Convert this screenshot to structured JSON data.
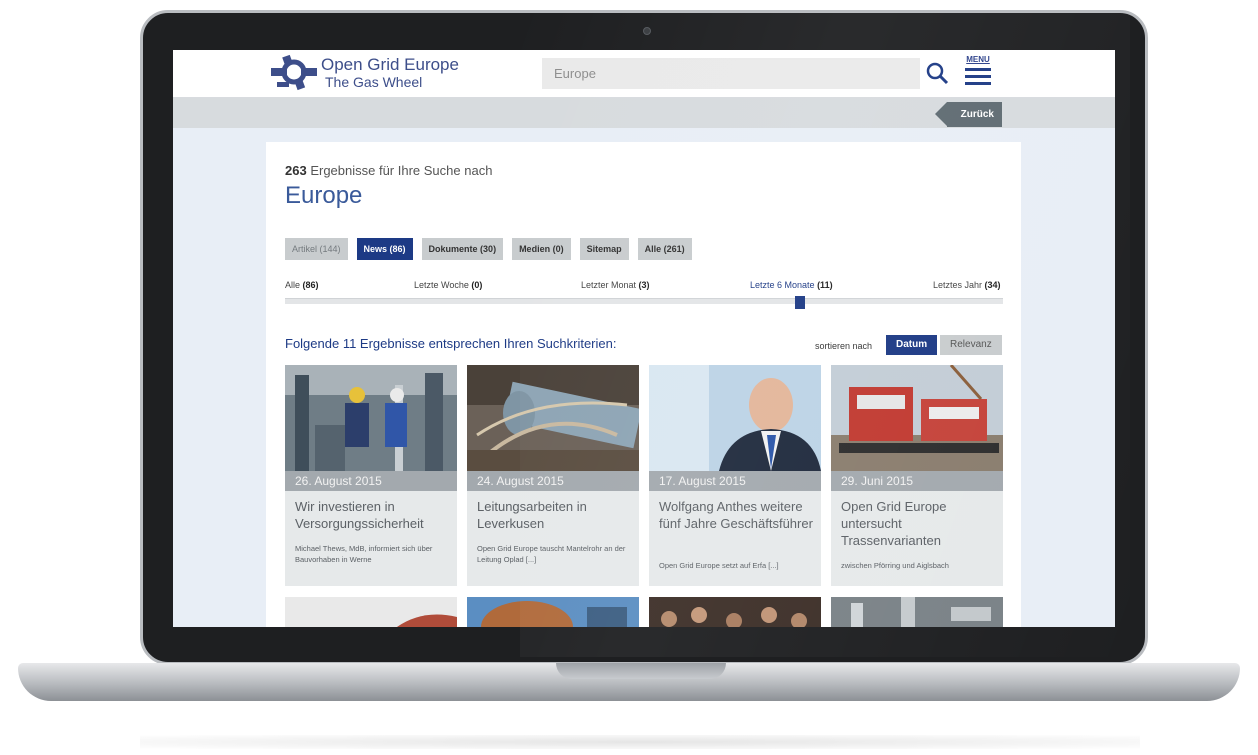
{
  "brand": {
    "name": "Open Grid Europe",
    "tagline": "The Gas Wheel"
  },
  "search": {
    "value": "Europe",
    "placeholder": ""
  },
  "menu": {
    "label": "MENU"
  },
  "back": {
    "label": "Zurück"
  },
  "results": {
    "count": "263",
    "count_suffix": " Ergebnisse für Ihre Suche nach",
    "query": "Europe",
    "filtered_title": "Folgende 11 Ergebnisse entsprechen Ihren Suchkriterien:"
  },
  "tabs": [
    {
      "label": "Artikel (144)",
      "state": "muted"
    },
    {
      "label": "News (86)",
      "state": "active"
    },
    {
      "label": "Dokumente (30)",
      "state": "normal"
    },
    {
      "label": "Medien (0)",
      "state": "normal"
    },
    {
      "label": "Sitemap",
      "state": "normal"
    },
    {
      "label": "Alle (261)",
      "state": "normal"
    }
  ],
  "time_range": {
    "options": [
      {
        "label": "Alle",
        "count": "(86)"
      },
      {
        "label": "Letzte Woche",
        "count": "(0)"
      },
      {
        "label": "Letzter Monat",
        "count": "(3)"
      },
      {
        "label": "Letzte 6 Monate",
        "count": "(11)"
      },
      {
        "label": "Letztes Jahr",
        "count": "(34)"
      }
    ],
    "selected_index": 3,
    "selected_fraction": 0.71
  },
  "sort": {
    "label": "sortieren nach",
    "options": [
      "Datum",
      "Relevanz"
    ],
    "selected": "Datum"
  },
  "news": [
    {
      "date": "26. August 2015",
      "title": "Wir investieren in Versorgungssicherheit",
      "desc": "Michael Thews, MdB, informiert sich über Bauvorhaben in Werne"
    },
    {
      "date": "24. August 2015",
      "title": "Leitungsarbeiten in Leverkusen",
      "desc": "Open Grid Europe tauscht Mantelrohr an der Leitung Oplad [...]"
    },
    {
      "date": "17. August 2015",
      "title": "Wolfgang Anthes weitere fünf Jahre Geschäftsführer",
      "desc": "Open Grid Europe setzt auf Erfa [...]"
    },
    {
      "date": "29. Juni 2015",
      "title": "Open Grid Europe untersucht Trassenvarianten",
      "desc": "zwischen Pförring und Aiglsbach"
    }
  ],
  "colors": {
    "brand_blue": "#1d3a85",
    "link_blue": "#3a5a9a",
    "tab_grey": "#c8ccce",
    "page_bg": "#e8eef6"
  }
}
